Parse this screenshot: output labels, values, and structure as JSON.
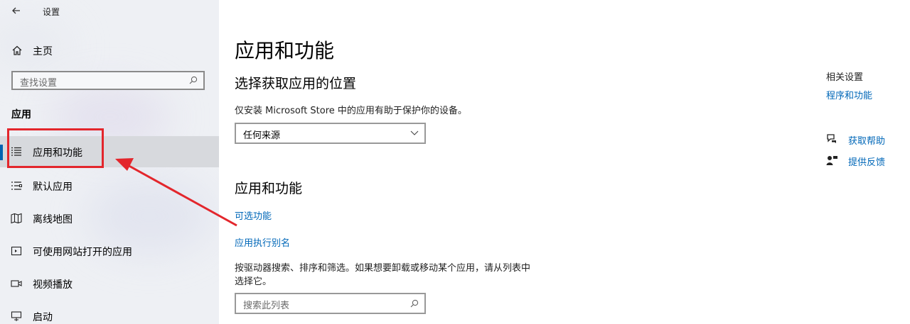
{
  "window": {
    "title": "设置"
  },
  "sidebar": {
    "home_label": "主页",
    "search_placeholder": "查找设置",
    "section_title": "应用",
    "items": [
      {
        "label": "应用和功能",
        "icon": "apps-features-icon",
        "active": true
      },
      {
        "label": "默认应用",
        "icon": "default-apps-icon"
      },
      {
        "label": "离线地图",
        "icon": "offline-maps-icon"
      },
      {
        "label": "可使用网站打开的应用",
        "icon": "apps-for-websites-icon"
      },
      {
        "label": "视频播放",
        "icon": "video-playback-icon"
      },
      {
        "label": "启动",
        "icon": "startup-icon"
      }
    ]
  },
  "main": {
    "title": "应用和功能",
    "source_section": {
      "heading": "选择获取应用的位置",
      "description": "仅安装 Microsoft Store 中的应用有助于保护你的设备。",
      "dropdown_value": "任何来源"
    },
    "apps_section": {
      "heading": "应用和功能",
      "link_optional": "可选功能",
      "link_alias": "应用执行别名",
      "description_line1": "按驱动器搜索、排序和筛选。如果想要卸载或移动某个应用，请从列表中",
      "description_line2": "选择它。",
      "search_placeholder": "搜索此列表"
    }
  },
  "related": {
    "title": "相关设置",
    "link_programs": "程序和功能",
    "help_label": "获取帮助",
    "feedback_label": "提供反馈"
  },
  "colors": {
    "accent": "#0063b1",
    "link": "#0067b8",
    "annotation_red": "#e3262c"
  }
}
